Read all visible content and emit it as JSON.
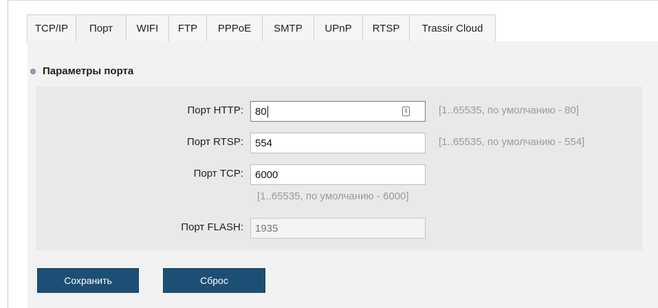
{
  "tabs": [
    {
      "label": "TCP/IP"
    },
    {
      "label": "Порт"
    },
    {
      "label": "WIFI"
    },
    {
      "label": "FTP"
    },
    {
      "label": "PPPoE"
    },
    {
      "label": "SMTP"
    },
    {
      "label": "UPnP"
    },
    {
      "label": "RTSP"
    },
    {
      "label": "Trassir Cloud"
    }
  ],
  "active_tab": "Порт",
  "section": {
    "title": "Параметры порта"
  },
  "fields": {
    "http": {
      "label": "Порт HTTP:",
      "value": "80",
      "hint": "[1..65535, по умолчанию - 80]"
    },
    "rtsp": {
      "label": "Порт RTSP:",
      "value": "554",
      "hint": "[1..65535, по умолчанию - 554]"
    },
    "tcp": {
      "label": "Порт TCP:",
      "value": "6000",
      "hint": "[1..65535, по умолчанию - 6000]"
    },
    "flash": {
      "label": "Порт FLASH:",
      "value": "1935"
    }
  },
  "buttons": {
    "save": "Сохранить",
    "reset": "Сброс"
  },
  "colors": {
    "button_bg": "#1d4f74",
    "panel_bg": "#f2f2f2",
    "content_bg": "#e9e9e9",
    "hint": "#9a9a9a"
  }
}
